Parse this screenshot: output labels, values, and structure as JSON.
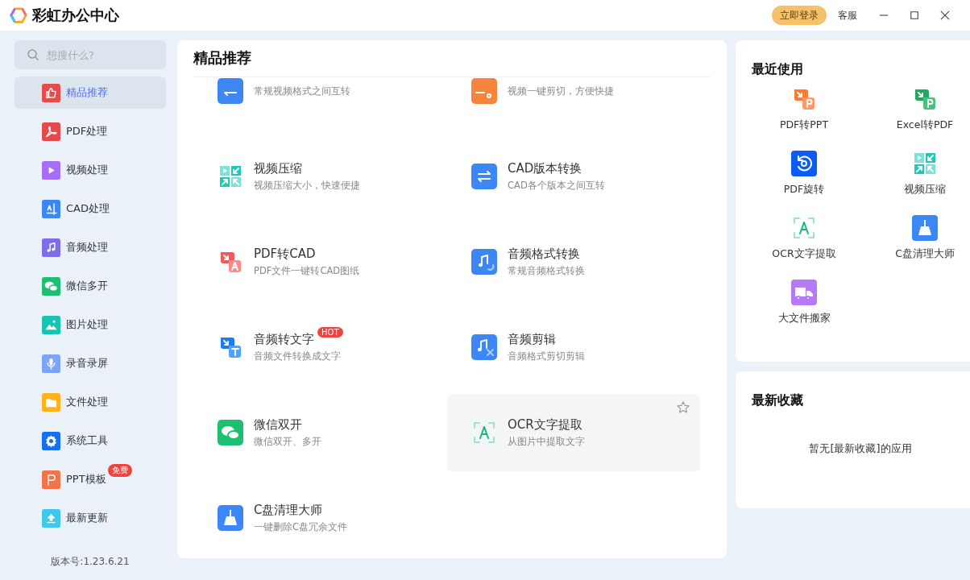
{
  "app": {
    "title": "彩虹办公中心",
    "login_button": "立即登录",
    "service_link": "客服"
  },
  "sidebar": {
    "search": {
      "placeholder": "想搜什么?"
    },
    "items": [
      {
        "label": "精品推荐",
        "kind": "thumb",
        "selected": true
      },
      {
        "label": "PDF处理",
        "kind": "pdf",
        "selected": false
      },
      {
        "label": "视频处理",
        "kind": "video",
        "selected": false
      },
      {
        "label": "CAD处理",
        "kind": "cad",
        "selected": false
      },
      {
        "label": "音频处理",
        "kind": "audio",
        "selected": false
      },
      {
        "label": "微信多开",
        "kind": "wechat",
        "selected": false
      },
      {
        "label": "图片处理",
        "kind": "image",
        "selected": false
      },
      {
        "label": "录音录屏",
        "kind": "mic",
        "selected": false
      },
      {
        "label": "文件处理",
        "kind": "folder",
        "selected": false
      },
      {
        "label": "系统工具",
        "kind": "gear",
        "selected": false
      },
      {
        "label": "PPT模板",
        "kind": "ppt",
        "selected": false,
        "badge": "免费"
      },
      {
        "label": "最新更新",
        "kind": "upload",
        "selected": false
      }
    ],
    "version": "版本号:1.23.6.21"
  },
  "main": {
    "title": "精品推荐",
    "tools": [
      {
        "description": "常规视频格式之间互转",
        "kind": "video-convert"
      },
      {
        "description": "视频一键剪切，方便快捷",
        "kind": "video-cut"
      },
      {
        "title": "视频压缩",
        "description": "视频压缩大小，快速便捷",
        "kind": "compress",
        "highlighted": false
      },
      {
        "title": "CAD版本转换",
        "description": "CAD各个版本之间互转",
        "kind": "cad-convert",
        "highlighted": false
      },
      {
        "title": "PDF转CAD",
        "description": "PDF文件一键转CAD图纸",
        "kind": "pdf-cad",
        "highlighted": false
      },
      {
        "title": "音频格式转换",
        "description": "常规音频格式转换",
        "kind": "audio-convert",
        "highlighted": false
      },
      {
        "title": "音频转文字",
        "description": "音频文件转换成文字",
        "kind": "audio-text",
        "highlighted": false,
        "badge": "HOT"
      },
      {
        "title": "音频剪辑",
        "description": "音频格式剪切剪辑",
        "kind": "audio-cut",
        "highlighted": false
      },
      {
        "title": "微信双开",
        "description": "微信双开、多开",
        "kind": "wechat",
        "highlighted": false
      },
      {
        "title": "OCR文字提取",
        "description": "从图片中提取文字",
        "kind": "ocr",
        "highlighted": true
      },
      {
        "title": "C盘清理大师",
        "description": "一键删除C盘冗余文件",
        "kind": "cleaner",
        "highlighted": false
      }
    ]
  },
  "recent": {
    "title": "最近使用",
    "items": [
      {
        "label": "PDF转PPT",
        "kind": "pdf-ppt"
      },
      {
        "label": "Excel转PDF",
        "kind": "excel-pdf"
      },
      {
        "label": "PDF旋转",
        "kind": "rotate"
      },
      {
        "label": "视频压缩",
        "kind": "compress"
      },
      {
        "label": "OCR文字提取",
        "kind": "ocr"
      },
      {
        "label": "C盘清理大师",
        "kind": "cleaner"
      },
      {
        "label": "大文件搬家",
        "kind": "truck"
      }
    ]
  },
  "favorites": {
    "title": "最新收藏",
    "empty_text": "暂无[最新收藏]的应用"
  }
}
